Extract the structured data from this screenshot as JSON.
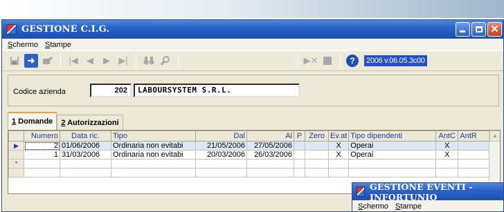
{
  "main_window": {
    "title": "GESTIONE C.I.G.",
    "menu": [
      "Schermo",
      "Stampe"
    ],
    "version": "2006 v.06.05.3c00"
  },
  "codice": {
    "label": "Codice azienda",
    "code": "202",
    "name": "LABOURSYSTEM S.R.L."
  },
  "tabs": [
    {
      "label": "1 Domande"
    },
    {
      "label": "2 Autorizzazioni"
    }
  ],
  "grid": {
    "columns": [
      "Numero",
      "Data ric.",
      "Tipo",
      "Dal",
      "Al",
      "P",
      "Zero",
      "Ev.at",
      "Tipo dipendenti",
      "AntC",
      "AntR"
    ],
    "rows": [
      {
        "numero": "2",
        "data_ric": "01/06/2006",
        "tipo": "Ordinaria non evitabi",
        "dal": "21/05/2006",
        "al": "27/05/2006",
        "p": "",
        "zero": "",
        "ev_at": "X",
        "tipo_dip": "Operai",
        "antc": "X",
        "antr": ""
      },
      {
        "numero": "1",
        "data_ric": "31/03/2006",
        "tipo": "Ordinaria non evitabi",
        "dal": "20/03/2006",
        "al": "26/03/2006",
        "p": "",
        "zero": "",
        "ev_at": "X",
        "tipo_dip": "Operai",
        "antc": "X",
        "antr": ""
      }
    ],
    "current_row_marker": "▶",
    "new_row_marker": "*"
  },
  "second_window": {
    "title": "GESTIONE EVENTI - INFORTUNIO",
    "menu": [
      "Schermo",
      "Stampe"
    ]
  }
}
